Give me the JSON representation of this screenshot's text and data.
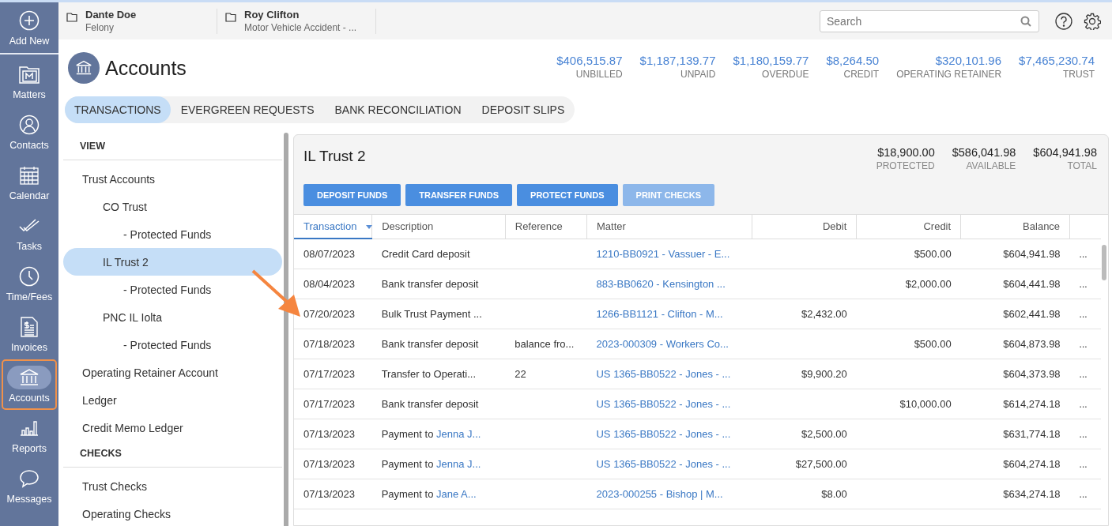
{
  "rail": [
    {
      "label": "Add New",
      "selected": false
    },
    {
      "label": "Matters",
      "selected": false
    },
    {
      "label": "Contacts",
      "selected": false
    },
    {
      "label": "Calendar",
      "selected": false
    },
    {
      "label": "Tasks",
      "selected": false
    },
    {
      "label": "Time/Fees",
      "selected": false
    },
    {
      "label": "Invoices",
      "selected": false
    },
    {
      "label": "Accounts",
      "selected": true
    },
    {
      "label": "Reports",
      "selected": false
    },
    {
      "label": "Messages",
      "selected": false
    }
  ],
  "recent_matters": [
    {
      "name": "Dante Doe",
      "subtitle": "Felony"
    },
    {
      "name": "Roy Clifton",
      "subtitle": "Motor Vehicle Accident - ..."
    }
  ],
  "search": {
    "placeholder": "Search"
  },
  "page_title": "Accounts",
  "summary": [
    {
      "amount": "$406,515.87",
      "label": "UNBILLED"
    },
    {
      "amount": "$1,187,139.77",
      "label": "UNPAID"
    },
    {
      "amount": "$1,180,159.77",
      "label": "OVERDUE"
    },
    {
      "amount": "$8,264.50",
      "label": "CREDIT"
    },
    {
      "amount": "$320,101.96",
      "label": "OPERATING RETAINER"
    },
    {
      "amount": "$7,465,230.74",
      "label": "TRUST"
    }
  ],
  "tabs": [
    {
      "label": "TRANSACTIONS",
      "selected": true
    },
    {
      "label": "EVERGREEN REQUESTS",
      "selected": false
    },
    {
      "label": "BANK RECONCILIATION",
      "selected": false
    },
    {
      "label": "DEPOSIT SLIPS",
      "selected": false
    }
  ],
  "nav_sections": [
    {
      "heading": "VIEW",
      "items": [
        {
          "label": "Trust Accounts",
          "selected": false,
          "children": [
            {
              "label": "CO Trust",
              "selected": false,
              "children": [
                {
                  "label": "- Protected Funds",
                  "selected": false
                }
              ]
            },
            {
              "label": "IL Trust 2",
              "selected": true,
              "children": [
                {
                  "label": "- Protected Funds",
                  "selected": false
                }
              ]
            },
            {
              "label": "PNC IL Iolta",
              "selected": false,
              "children": [
                {
                  "label": "- Protected Funds",
                  "selected": false
                }
              ]
            }
          ]
        },
        {
          "label": "Operating Retainer Account",
          "selected": false
        },
        {
          "label": "Ledger",
          "selected": false
        },
        {
          "label": "Credit Memo Ledger",
          "selected": false
        }
      ]
    },
    {
      "heading": "CHECKS",
      "items": [
        {
          "label": "Trust Checks",
          "selected": false
        },
        {
          "label": "Operating Checks",
          "selected": false
        }
      ]
    }
  ],
  "account": {
    "title": "IL Trust 2",
    "totals": [
      {
        "amount": "$18,900.00",
        "label": "PROTECTED"
      },
      {
        "amount": "$586,041.98",
        "label": "AVAILABLE"
      },
      {
        "amount": "$604,941.98",
        "label": "TOTAL"
      }
    ],
    "buttons": [
      {
        "label": "DEPOSIT FUNDS",
        "disabled": false
      },
      {
        "label": "TRANSFER FUNDS",
        "disabled": false
      },
      {
        "label": "PROTECT FUNDS",
        "disabled": false
      },
      {
        "label": "PRINT CHECKS",
        "disabled": true
      }
    ]
  },
  "table": {
    "columns": [
      {
        "label": "Transaction",
        "sorted": true
      },
      {
        "label": "Description",
        "sorted": false
      },
      {
        "label": "Reference",
        "sorted": false
      },
      {
        "label": "Matter",
        "sorted": false
      },
      {
        "label": "Debit",
        "sorted": false
      },
      {
        "label": "Credit",
        "sorted": false
      },
      {
        "label": "Balance",
        "sorted": false
      }
    ],
    "rows": [
      {
        "date": "08/07/2023",
        "description": "Credit Card deposit",
        "matter": "1210-BB0921 - Vassuer - E...",
        "credit": "$500.00",
        "balance": "$604,941.98",
        "more": "..."
      },
      {
        "date": "08/04/2023",
        "description": "Bank transfer deposit",
        "matter": "883-BB0620 - Kensington ...",
        "credit": "$2,000.00",
        "balance": "$604,441.98",
        "more": "..."
      },
      {
        "date": "07/20/2023",
        "description": "Bulk Trust Payment ...",
        "matter": "1266-BB1121 - Clifton - M...",
        "debit": "$2,432.00",
        "balance": "$602,441.98",
        "more": "..."
      },
      {
        "date": "07/18/2023",
        "description": "Bank transfer deposit",
        "reference": "balance fro...",
        "matter": "2023-000309 - Workers Co...",
        "credit": "$500.00",
        "balance": "$604,873.98",
        "more": "..."
      },
      {
        "date": "07/17/2023",
        "description": "Transfer to Operati...",
        "reference": "22",
        "matter": "US 1365-BB0522 - Jones - ...",
        "debit": "$9,900.20",
        "balance": "$604,373.98",
        "more": "..."
      },
      {
        "date": "07/17/2023",
        "description": "Bank transfer deposit",
        "matter": "US 1365-BB0522 - Jones - ...",
        "credit": "$10,000.00",
        "balance": "$614,274.18",
        "more": "..."
      },
      {
        "date": "07/13/2023",
        "description": "Payment to",
        "description_link": "Jenna J...",
        "matter": "US 1365-BB0522 - Jones - ...",
        "debit": "$2,500.00",
        "balance": "$631,774.18",
        "more": "..."
      },
      {
        "date": "07/13/2023",
        "description": "Payment to",
        "description_link": "Jenna J...",
        "matter": "US 1365-BB0522 - Jones - ...",
        "debit": "$27,500.00",
        "balance": "$604,274.18",
        "more": "..."
      },
      {
        "date": "07/13/2023",
        "description": "Payment to",
        "description_link": "Jane A...",
        "matter": "2023-000255 - Bishop | M...",
        "debit": "$8.00",
        "balance": "$634,274.18",
        "more": "..."
      }
    ]
  }
}
